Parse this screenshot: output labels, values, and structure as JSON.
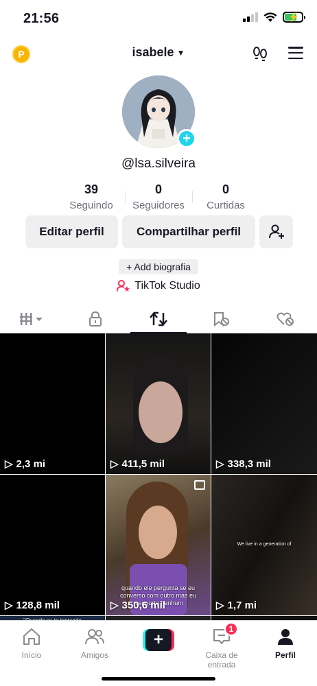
{
  "status_bar": {
    "time": "21:56"
  },
  "top_nav": {
    "username": "isabele"
  },
  "profile": {
    "handle": "@lsa.silveira",
    "stats": [
      {
        "value": "39",
        "label": "Seguindo"
      },
      {
        "value": "0",
        "label": "Seguidores"
      },
      {
        "value": "0",
        "label": "Curtidas"
      }
    ],
    "buttons": {
      "edit": "Editar perfil",
      "share": "Compartilhar perfil"
    },
    "bio": "+ Add biografia",
    "studio": "TikTok Studio"
  },
  "tabs": [
    {
      "icon": "grid-icon",
      "active": false
    },
    {
      "icon": "lock-icon",
      "active": false
    },
    {
      "icon": "repost-icon",
      "active": true
    },
    {
      "icon": "bookmark-hidden-icon",
      "active": false
    },
    {
      "icon": "heart-hidden-icon",
      "active": false
    }
  ],
  "videos": [
    {
      "views": "2,3 mi"
    },
    {
      "views": "411,5 mil"
    },
    {
      "views": "338,3 mil"
    },
    {
      "views": "128,8 mil"
    },
    {
      "views": "350,6 mil",
      "caption": "quando ele pergunta se eu converso com outro mas eu n suporto nenhum"
    },
    {
      "views": "1,7 mi",
      "caption": "We live in a generation of"
    },
    {
      "caption": "\"Quando eu to tentando"
    }
  ],
  "bottom_nav": {
    "home": "Início",
    "friends": "Amigos",
    "inbox": "Caixa de entrada",
    "inbox_badge": "1",
    "profile": "Perfil"
  },
  "colors": {
    "accent_cyan": "#20d5ec",
    "accent_red": "#fe2c55",
    "coin": "#f7b500"
  }
}
